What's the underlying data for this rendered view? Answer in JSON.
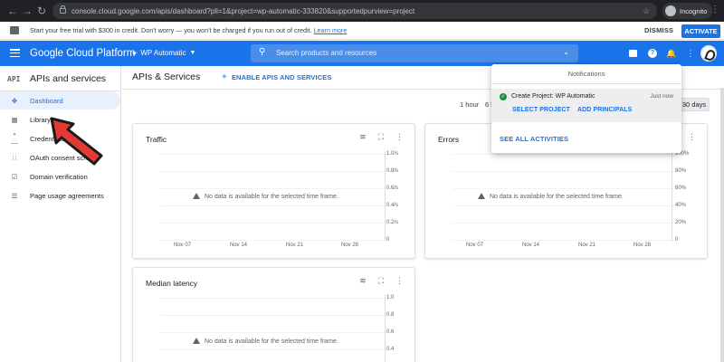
{
  "browser": {
    "url": "console.cloud.google.com/apis/dashboard?pli=1&project=wp-automatic-333820&supportedpurview=project",
    "profile_label": "Incognito"
  },
  "banner": {
    "message": "Start your free trial with $300 in credit. Don't worry — you won't be charged if you run out of credit.",
    "learn_more": "Learn more",
    "dismiss": "DISMISS",
    "activate": "ACTIVATE"
  },
  "header": {
    "title": "Google Cloud Platform",
    "project": "WP Automatic",
    "search_placeholder": "Search products and resources"
  },
  "sidebar": {
    "badge": "API",
    "title": "APIs and services",
    "items": [
      {
        "label": "Dashboard",
        "icon": "dashboard-icon",
        "active": true
      },
      {
        "label": "Library",
        "icon": "library-icon",
        "active": false
      },
      {
        "label": "Credentials",
        "icon": "key-icon",
        "active": false
      },
      {
        "label": "OAuth consent screen",
        "icon": "consent-icon",
        "active": false
      },
      {
        "label": "Domain verification",
        "icon": "checkbox-icon",
        "active": false
      },
      {
        "label": "Page usage agreements",
        "icon": "settings-list-icon",
        "active": false
      }
    ]
  },
  "main": {
    "title": "APIs & Services",
    "enable_button": "ENABLE APIS AND SERVICES",
    "time_ranges": [
      "1 hour",
      "6 h",
      "30 days"
    ],
    "no_data": "No data is available for the selected time frame."
  },
  "cards": [
    {
      "title": "Traffic",
      "y_ticks": [
        "1.0/s",
        "0.8/s",
        "0.6/s",
        "0.4/s",
        "0.2/s",
        "0"
      ],
      "x_ticks": [
        "Nov 07",
        "Nov 14",
        "Nov 21",
        "Nov 28"
      ]
    },
    {
      "title": "Errors",
      "y_ticks": [
        "100%",
        "80%",
        "60%",
        "40%",
        "20%",
        "0"
      ],
      "x_ticks": [
        "Nov 07",
        "Nov 14",
        "Nov 21",
        "Nov 28"
      ]
    },
    {
      "title": "Median latency",
      "y_ticks": [
        "1.0",
        "0.8",
        "0.6",
        "0.4"
      ],
      "x_ticks": []
    }
  ],
  "notifications": {
    "header": "Notifications",
    "item": {
      "title": "Create Project: WP Automatic",
      "time": "Just now",
      "actions": [
        "SELECT PROJECT",
        "ADD PRINCIPALS"
      ]
    },
    "see_all": "SEE ALL ACTIVITIES"
  },
  "colors": {
    "accent": "#1a73e8",
    "success": "#1e8e3e",
    "pointer": "#e53935"
  }
}
